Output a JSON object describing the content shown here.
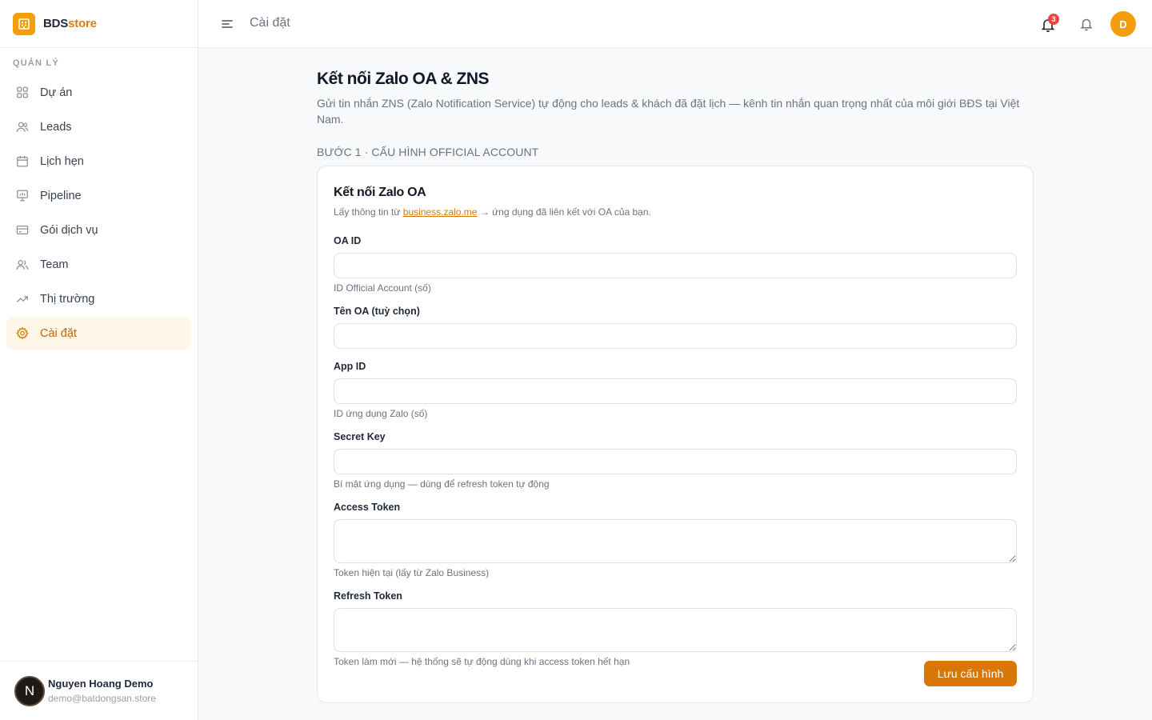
{
  "brand": {
    "name_part1": "BDS",
    "name_part2": "store",
    "icon": "building-icon"
  },
  "sidebar": {
    "section_label": "QUẢN LÝ",
    "items": [
      {
        "label": "Dự án",
        "icon": "grid-icon"
      },
      {
        "label": "Leads",
        "icon": "users-icon"
      },
      {
        "label": "Lịch hẹn",
        "icon": "calendar-icon"
      },
      {
        "label": "Pipeline",
        "icon": "presentation-chart-icon"
      },
      {
        "label": "Gói dịch vụ",
        "icon": "credit-card-icon"
      },
      {
        "label": "Team",
        "icon": "team-icon"
      },
      {
        "label": "Thị trường",
        "icon": "trending-up-icon"
      },
      {
        "label": "Cài đặt",
        "icon": "gear-icon",
        "active": true
      }
    ],
    "user": {
      "initial": "N",
      "name": "Nguyen Hoang Demo",
      "email": "demo@batdongsan.store"
    }
  },
  "header": {
    "title": "Cài đặt",
    "notification_count": "3",
    "avatar_initial": "D"
  },
  "main": {
    "title": "Kết nối Zalo OA & ZNS",
    "description": "Gửi tin nhắn ZNS (Zalo Notification Service) tự động cho leads & khách đã đặt lịch — kênh tin nhắn quan trọng nhất của môi giới BĐS tại Việt Nam.",
    "step_label": "BƯỚC 1 · CẤU HÌNH OFFICIAL ACCOUNT",
    "card": {
      "title": "Kết nối Zalo OA",
      "subtitle_prefix": "Lấy thông tin từ ",
      "subtitle_link": "business.zalo.me",
      "subtitle_suffix": " → ứng dụng đã liên kết với OA của bạn.",
      "fields": {
        "oa_id": {
          "label": "OA ID",
          "value": "",
          "hint": "ID Official Account (số)"
        },
        "oa_name": {
          "label": "Tên OA (tuỳ chọn)",
          "value": ""
        },
        "app_id": {
          "label": "App ID",
          "value": "",
          "hint": "ID ứng dụng Zalo (số)"
        },
        "secret_key": {
          "label": "Secret Key",
          "value": "",
          "hint": "Bí mật ứng dụng — dùng để refresh token tự động"
        },
        "access_token": {
          "label": "Access Token",
          "value": "",
          "hint": "Token hiện tại (lấy từ Zalo Business)"
        },
        "refresh_token": {
          "label": "Refresh Token",
          "value": "",
          "hint": "Token làm mới — hệ thống sẽ tự động dùng khi access token hết hạn"
        }
      },
      "save_label": "Lưu cấu hình"
    }
  },
  "colors": {
    "accent": "#d97706",
    "brand": "#f59e0b",
    "badge": "#ef4444",
    "active_bg": "#fef6e7"
  }
}
